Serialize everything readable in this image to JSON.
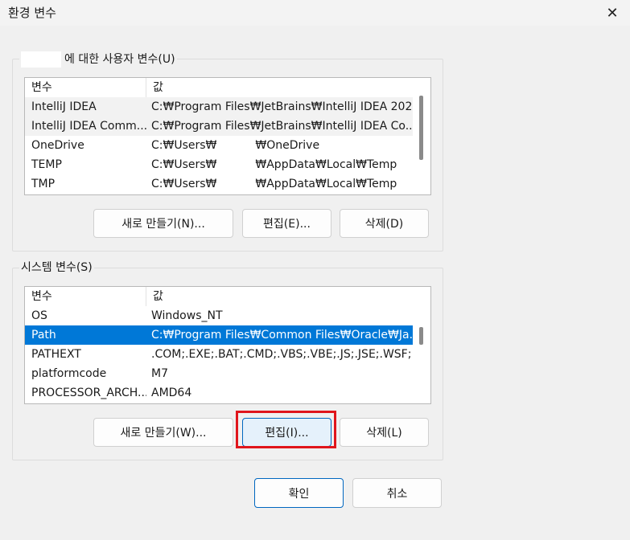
{
  "window": {
    "title": "환경 변수",
    "close_icon": "close-icon"
  },
  "user_vars": {
    "legend": "에 대한 사용자 변수(U)",
    "headers": [
      "변수",
      "값"
    ],
    "rows": [
      {
        "name": "IntelliJ IDEA",
        "value": "C:₩Program Files₩JetBrains₩IntelliJ IDEA 202...",
        "style": "alt"
      },
      {
        "name": "IntelliJ IDEA Comm...",
        "value": "C:₩Program Files₩JetBrains₩IntelliJ IDEA Co...",
        "style": "alt"
      },
      {
        "name": "OneDrive",
        "value_pre": "C:₩Users₩",
        "value_post": "₩OneDrive",
        "style": ""
      },
      {
        "name": "TEMP",
        "value_pre": "C:₩Users₩",
        "value_post": "₩AppData₩Local₩Temp",
        "style": ""
      },
      {
        "name": "TMP",
        "value_pre": "C:₩Users₩",
        "value_post": "₩AppData₩Local₩Temp",
        "style": ""
      }
    ],
    "buttons": {
      "new": "새로 만들기(N)...",
      "edit": "편집(E)...",
      "delete": "삭제(D)"
    }
  },
  "system_vars": {
    "legend": "시스템 변수(S)",
    "headers": [
      "변수",
      "값"
    ],
    "rows": [
      {
        "name": "OS",
        "value": "Windows_NT",
        "style": ""
      },
      {
        "name": "Path",
        "value": "C:₩Program Files₩Common Files₩Oracle₩Ja...",
        "style": "selected"
      },
      {
        "name": "PATHEXT",
        "value": ".COM;.EXE;.BAT;.CMD;.VBS;.VBE;.JS;.JSE;.WSF;...",
        "style": ""
      },
      {
        "name": "platformcode",
        "value": "M7",
        "style": ""
      },
      {
        "name": "PROCESSOR_ARCH...",
        "value": "AMD64",
        "style": ""
      }
    ],
    "buttons": {
      "new": "새로 만들기(W)...",
      "edit": "편집(I)...",
      "delete": "삭제(L)"
    }
  },
  "footer": {
    "ok": "확인",
    "cancel": "취소"
  },
  "colors": {
    "selection": "#0078d7",
    "highlight": "#e0151c",
    "primary_border": "#0067c0"
  }
}
